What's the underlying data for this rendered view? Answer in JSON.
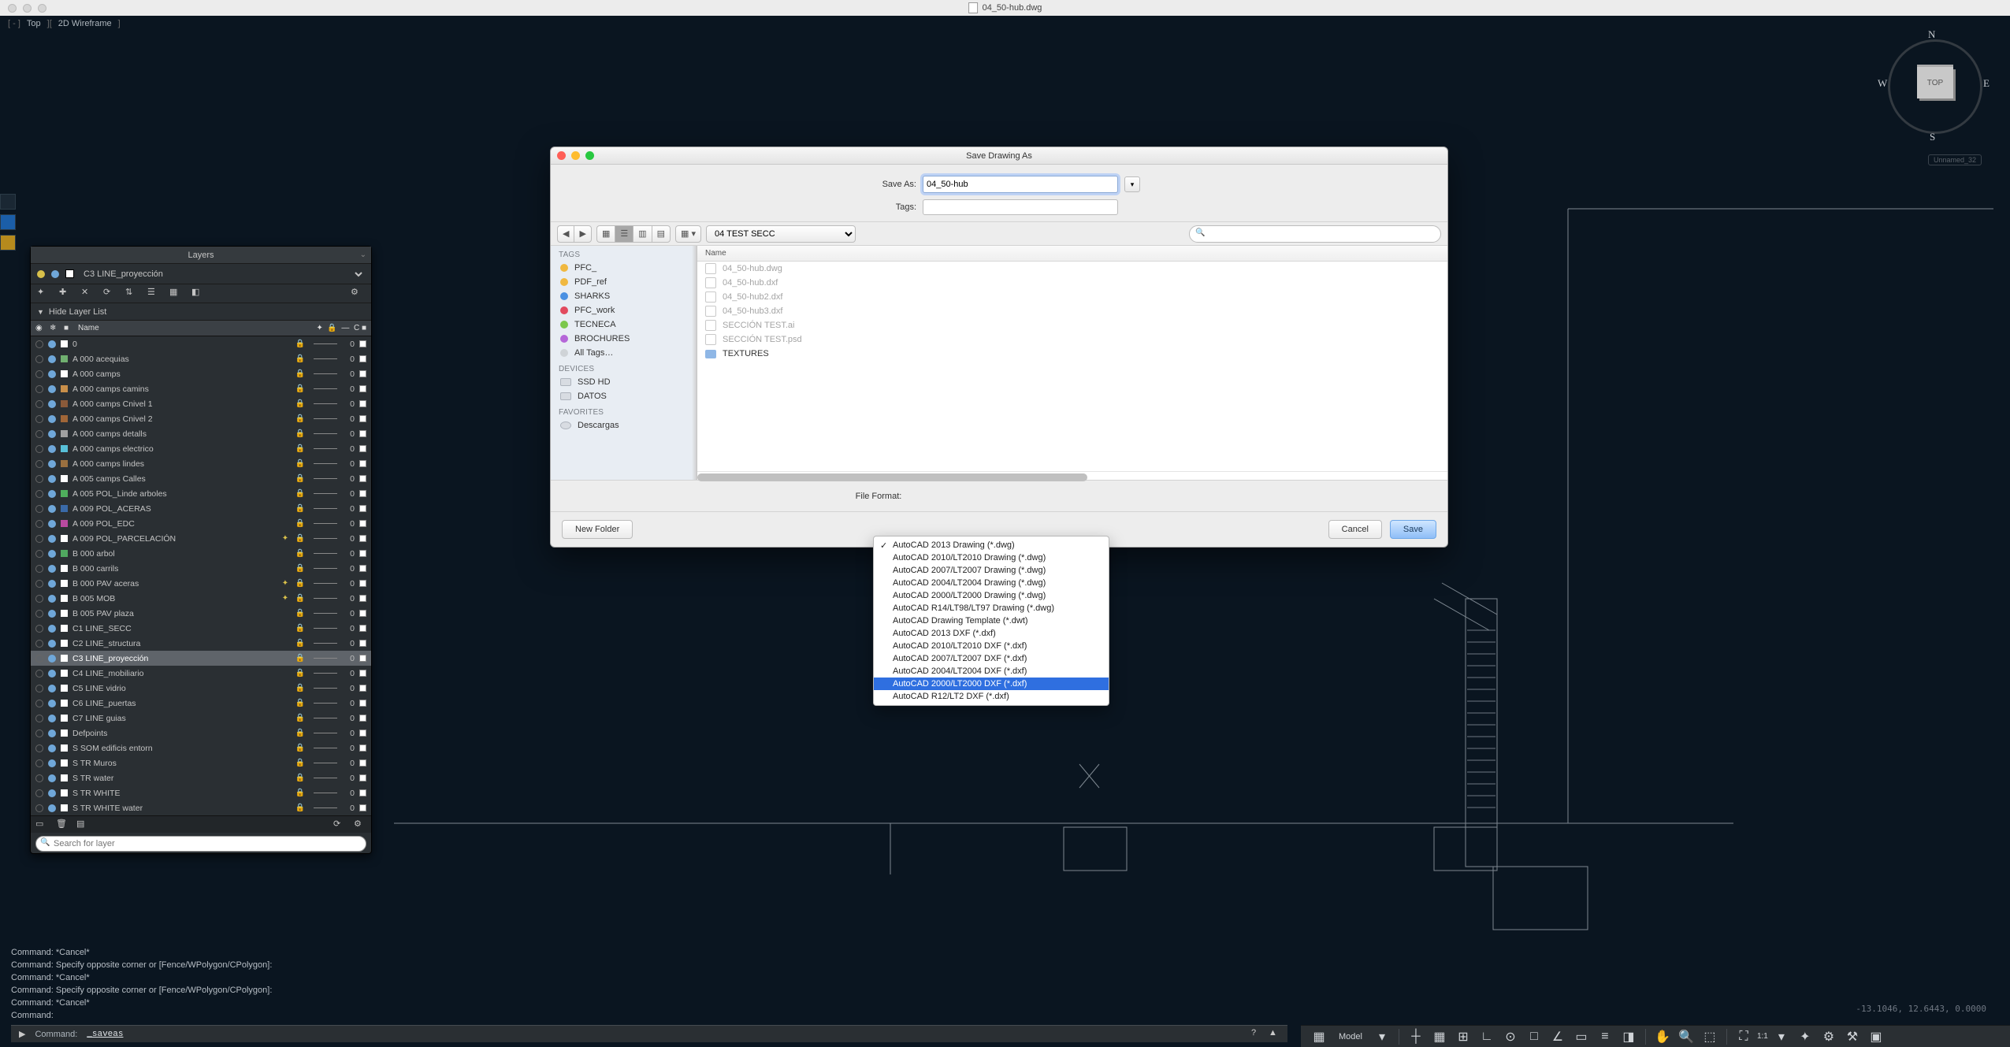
{
  "window": {
    "title": "04_50-hub.dwg"
  },
  "viewport": {
    "label_left": "Top",
    "label_right": "2D Wireframe",
    "unnamed": "Unnamed_32"
  },
  "navcube": {
    "face": "TOP",
    "n": "N",
    "s": "S",
    "e": "E",
    "w": "W"
  },
  "layers_panel": {
    "title": "Layers",
    "current": "C3 LINE_proyección",
    "hide": "Hide Layer List",
    "cols": {
      "name": "Name",
      "end": "C"
    },
    "search_placeholder": "Search for layer",
    "rows": [
      {
        "name": "0",
        "color": "#ffffff",
        "starred": false
      },
      {
        "name": "A 000 acequias",
        "color": "#70b070",
        "starred": false
      },
      {
        "name": "A 000 camps",
        "color": "#ffffff",
        "starred": false
      },
      {
        "name": "A 000 camps camins",
        "color": "#c98f4a",
        "starred": false
      },
      {
        "name": "A 000 camps Cnivel 1",
        "color": "#8a5a3a",
        "starred": false
      },
      {
        "name": "A 000 camps Cnivel 2",
        "color": "#a06638",
        "starred": false
      },
      {
        "name": "A 000 camps detalls",
        "color": "#a0a0a0",
        "starred": false
      },
      {
        "name": "A 000 camps electrico",
        "color": "#58c0d8",
        "starred": false
      },
      {
        "name": "A 000 camps lindes",
        "color": "#9a7040",
        "starred": false
      },
      {
        "name": "A 005 camps Calles",
        "color": "#ffffff",
        "starred": false
      },
      {
        "name": "A 005 POL_Linde arboles",
        "color": "#4fae5d",
        "starred": false
      },
      {
        "name": "A 009 POL_ACERAS",
        "color": "#3a6aa8",
        "starred": false
      },
      {
        "name": "A 009 POL_EDC",
        "color": "#b84aa0",
        "starred": false
      },
      {
        "name": "A 009 POL_PARCELACIÓN",
        "color": "#ffffff",
        "starred": true
      },
      {
        "name": "B 000 arbol",
        "color": "#50a860",
        "starred": false
      },
      {
        "name": "B 000 carrils",
        "color": "#ffffff",
        "starred": false
      },
      {
        "name": "B 000 PAV aceras",
        "color": "#ffffff",
        "starred": true
      },
      {
        "name": "B 005 MOB",
        "color": "#ffffff",
        "starred": true
      },
      {
        "name": "B 005 PAV plaza",
        "color": "#ffffff",
        "starred": false
      },
      {
        "name": "C1 LINE_SECC",
        "color": "#ffffff",
        "starred": false
      },
      {
        "name": "C2 LINE_structura",
        "color": "#ffffff",
        "starred": false
      },
      {
        "name": "C3 LINE_proyección",
        "color": "#ffffff",
        "starred": false,
        "selected": true
      },
      {
        "name": "C4 LINE_mobiliario",
        "color": "#ffffff",
        "starred": false
      },
      {
        "name": "C5 LINE vidrio",
        "color": "#ffffff",
        "starred": false
      },
      {
        "name": "C6 LINE_puertas",
        "color": "#ffffff",
        "starred": false
      },
      {
        "name": "C7 LINE guias",
        "color": "#ffffff",
        "starred": false
      },
      {
        "name": "Defpoints",
        "color": "#ffffff",
        "starred": false
      },
      {
        "name": "S SOM edificis entorn",
        "color": "#ffffff",
        "starred": false
      },
      {
        "name": "S TR Muros",
        "color": "#ffffff",
        "starred": false
      },
      {
        "name": "S TR water",
        "color": "#ffffff",
        "starred": false
      },
      {
        "name": "S TR WHITE",
        "color": "#ffffff",
        "starred": false
      },
      {
        "name": "S TR WHITE water",
        "color": "#ffffff",
        "starred": false
      }
    ]
  },
  "dialog": {
    "title": "Save Drawing As",
    "save_as_label": "Save As:",
    "tags_label": "Tags:",
    "filename": "04_50-hub",
    "folder": "04 TEST SECC",
    "file_format_label": "File Format:",
    "new_folder": "New Folder",
    "cancel": "Cancel",
    "save": "Save",
    "sidebar": {
      "sec_tags": "TAGS",
      "sec_devices": "DEVICES",
      "sec_favorites": "FAVORITES",
      "tags": [
        {
          "label": "PFC_",
          "color": "#f0b840"
        },
        {
          "label": "PDF_ref",
          "color": "#f0b840"
        },
        {
          "label": "SHARKS",
          "color": "#4a90e2"
        },
        {
          "label": "PFC_work",
          "color": "#e24a5e"
        },
        {
          "label": "TECNECA",
          "color": "#7cc74c"
        },
        {
          "label": "BROCHURES",
          "color": "#b566d8"
        },
        {
          "label": "All Tags…",
          "color": "#cfd3d7"
        }
      ],
      "devices": [
        "SSD HD",
        "DATOS"
      ],
      "favorites": [
        "Descargas"
      ]
    },
    "files_header": "Name",
    "files": [
      {
        "name": "04_50-hub.dwg",
        "dim": true,
        "folder": false
      },
      {
        "name": "04_50-hub.dxf",
        "dim": true,
        "folder": false
      },
      {
        "name": "04_50-hub2.dxf",
        "dim": true,
        "folder": false
      },
      {
        "name": "04_50-hub3.dxf",
        "dim": true,
        "folder": false
      },
      {
        "name": "SECCIÓN TEST.ai",
        "dim": true,
        "folder": false
      },
      {
        "name": "SECCIÓN TEST.psd",
        "dim": true,
        "folder": false
      },
      {
        "name": "TEXTURES",
        "dim": false,
        "folder": true
      }
    ],
    "formats": [
      {
        "label": "AutoCAD 2013 Drawing (*.dwg)",
        "checked": true
      },
      {
        "label": "AutoCAD 2010/LT2010 Drawing (*.dwg)"
      },
      {
        "label": "AutoCAD 2007/LT2007 Drawing (*.dwg)"
      },
      {
        "label": "AutoCAD 2004/LT2004 Drawing (*.dwg)"
      },
      {
        "label": "AutoCAD 2000/LT2000 Drawing (*.dwg)"
      },
      {
        "label": "AutoCAD R14/LT98/LT97 Drawing (*.dwg)"
      },
      {
        "label": "AutoCAD Drawing Template (*.dwt)"
      },
      {
        "label": "AutoCAD 2013 DXF (*.dxf)"
      },
      {
        "label": "AutoCAD 2010/LT2010 DXF (*.dxf)"
      },
      {
        "label": "AutoCAD 2007/LT2007 DXF (*.dxf)"
      },
      {
        "label": "AutoCAD 2004/LT2004 DXF (*.dxf)"
      },
      {
        "label": "AutoCAD 2000/LT2000 DXF (*.dxf)",
        "selected": true
      },
      {
        "label": "AutoCAD R12/LT2 DXF (*.dxf)"
      }
    ]
  },
  "command": {
    "lines": [
      "Command: *Cancel*",
      "Command: Specify opposite corner or [Fence/WPolygon/CPolygon]:",
      "Command: *Cancel*",
      "Command: Specify opposite corner or [Fence/WPolygon/CPolygon]:",
      "Command: *Cancel*",
      "Command:"
    ],
    "prompt_label": "Command:",
    "prompt_value": "_saveas"
  },
  "coords": "-13.1046, 12.6443, 0.0000",
  "status": {
    "model": "Model",
    "ratio": "1:1"
  }
}
